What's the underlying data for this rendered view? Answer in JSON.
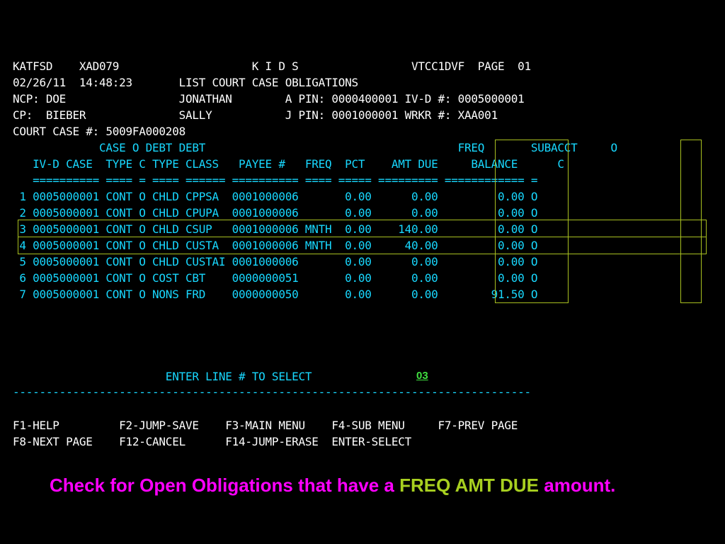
{
  "header": {
    "line1": "KATFSD    XAD079                    K I D S                 VTCC1DVF  PAGE  01",
    "line2": "02/26/11  14:48:23       LIST COURT CASE OBLIGATIONS",
    "line3": "NCP: DOE                 JONATHAN        A PIN: 0000400001 IV-D #: 0005000001",
    "line4": "CP:  BIEBER              SALLY           J PIN: 0001000001 WRKR #: XAA001",
    "line5": "COURT CASE #: 5009FA000208"
  },
  "table": {
    "head1": "             CASE O DEBT DEBT                                      FREQ       SUBACCT     O",
    "head2": "   IV-D CASE  TYPE C TYPE CLASS   PAYEE #   FREQ  PCT    AMT DUE     BALANCE      C",
    "divider": "   ========== ==== = ==== ====== ========== ==== ===== ========= ============ =",
    "rows": [
      " 1 0005000001 CONT O CHLD CPPSA  0001000006       0.00      0.00         0.00 O",
      " 2 0005000001 CONT O CHLD CPUPA  0001000006       0.00      0.00         0.00 O",
      " 3 0005000001 CONT O CHLD CSUP   0001000006 MNTH  0.00    140.00         0.00 O",
      " 4 0005000001 CONT O CHLD CUSTA  0001000006 MNTH  0.00     40.00         0.00 O",
      " 5 0005000001 CONT O CHLD CUSTAI 0001000006       0.00      0.00         0.00 O",
      " 6 0005000001 CONT O COST CBT    0000000051       0.00      0.00         0.00 O",
      " 7 0005000001 CONT O NONS FRD    0000000050       0.00      0.00        91.50 O"
    ]
  },
  "prompt": {
    "label": "                       ENTER LINE # TO SELECT",
    "value": "03"
  },
  "separator": "------------------------------------------------------------------------------",
  "fkeys": {
    "row1": "F1-HELP         F2-JUMP-SAVE    F3-MAIN MENU    F4-SUB MENU     F7-PREV PAGE",
    "row2": "F8-NEXT PAGE    F12-CANCEL      F14-JUMP-ERASE  ENTER-SELECT"
  },
  "caption": {
    "part1": "Check for Open Obligations that have a ",
    "part2": "FREQ AMT DUE",
    "part3": " amount."
  },
  "colors": {
    "background": "#000000",
    "label_text": "#ffffff",
    "field_text": "#18d8ff",
    "highlight_box": "#a8c020",
    "caption_magenta": "#ff00ff",
    "caption_green": "#a8d020"
  }
}
